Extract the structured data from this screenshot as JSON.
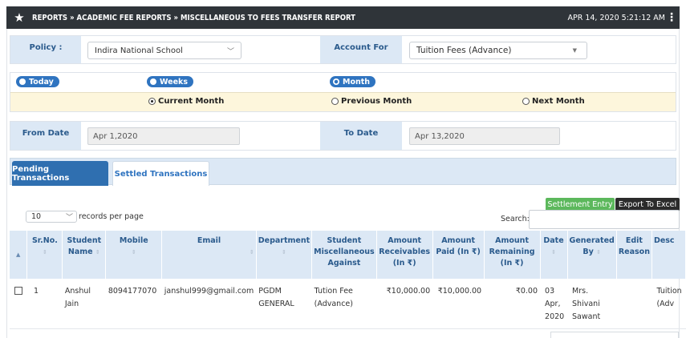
{
  "header": {
    "breadcrumb": "REPORTS » ACADEMIC FEE REPORTS » MISCELLANEOUS TO FEES TRANSFER REPORT",
    "datetime": "APR 14, 2020  5:21:12 AM"
  },
  "filters": {
    "policy_label": "Policy :",
    "policy_value": "Indira National School",
    "account_label": "Account For",
    "account_value": "Tuition Fees (Advance)",
    "period_pills": [
      "Today",
      "Weeks",
      "Month"
    ],
    "month_options": [
      "Current Month",
      "Previous Month",
      "Next Month"
    ],
    "from_label": "From Date",
    "from_value": "Apr 1,2020",
    "to_label": "To Date",
    "to_value": "Apr 13,2020"
  },
  "tabs": [
    "Pending Transactions",
    "Settled Transactions"
  ],
  "actions": {
    "settlement": "Settlement Entry",
    "export": "Export To Excel"
  },
  "table_controls": {
    "page_size": "10",
    "records_text": "records per page",
    "search_label": "Search:"
  },
  "columns": [
    "Sr.No.",
    "Student Name",
    "Mobile",
    "Email",
    "Department",
    "Student Miscellaneous Against",
    "Amount Receivables (In ₹)",
    "Amount Paid (In ₹)",
    "Amount Remaining (In ₹)",
    "Date",
    "Generated By",
    "Edit Reason",
    "Desc"
  ],
  "rows": [
    {
      "sr": "1",
      "name": "Anshul Jain",
      "mobile": "8094177070",
      "email": "janshul999@gmail.com",
      "department": "PGDM GENERAL",
      "against": "Tution Fee (Advance)",
      "receivable": "₹10,000.00",
      "paid": "₹10,000.00",
      "remaining": "₹0.00",
      "date": "03 Apr, 2020",
      "generated_by": "Mrs. Shivani Sawant",
      "edit_reason": "",
      "desc": "Tuition (Adv"
    }
  ]
}
